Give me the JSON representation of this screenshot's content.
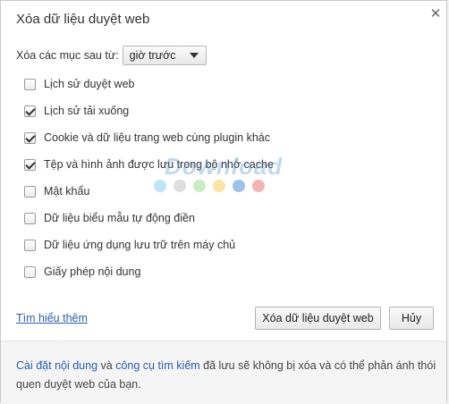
{
  "dialog": {
    "title": "Xóa dữ liệu duyệt web",
    "close_icon": "close-icon",
    "period_label": "Xóa các mục sau từ:",
    "period_value": "giờ trước",
    "options": [
      {
        "label": "Lịch sử duyệt web",
        "checked": false
      },
      {
        "label": "Lịch sử tải xuống",
        "checked": true
      },
      {
        "label": "Cookie và dữ liệu trang web cùng plugin khác",
        "checked": true
      },
      {
        "label": "Tệp và hình ảnh được lưu trong bộ nhớ cache",
        "checked": true
      },
      {
        "label": "Mật khẩu",
        "checked": false
      },
      {
        "label": "Dữ liệu biểu mẫu tự động điền",
        "checked": false
      },
      {
        "label": "Dữ liệu ứng dụng lưu trữ trên máy chủ",
        "checked": false
      },
      {
        "label": "Giấy phép nội dung",
        "checked": false
      }
    ],
    "learn_more": "Tìm hiểu thêm",
    "clear_button": "Xóa dữ liệu duyệt web",
    "cancel_button": "Hủy"
  },
  "footer": {
    "link1": "Cài đặt nội dung",
    "and": " và ",
    "link2": "công cụ tìm kiếm",
    "rest": " đã lưu sẽ không bị xóa và có thể phản ánh thói quen duyệt web của bạn."
  },
  "watermark": {
    "text": "Download",
    "dot_colors": [
      "#bfe4f5",
      "#dedede",
      "#c9ecc0",
      "#fbe3a3",
      "#9cc3ea",
      "#f4b3b3"
    ]
  }
}
